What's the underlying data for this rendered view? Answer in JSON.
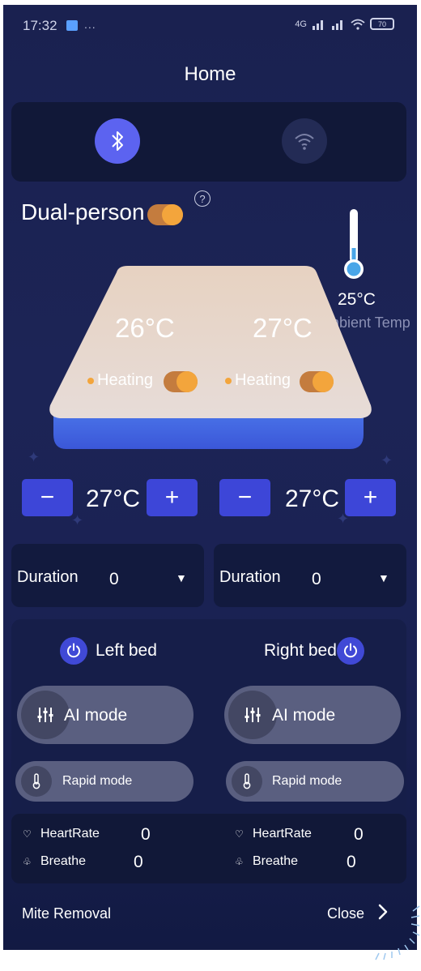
{
  "status_bar": {
    "time": "17:32",
    "dots": "...",
    "signal_text": "4G",
    "battery": "70"
  },
  "header": {
    "title": "Home"
  },
  "connection": {
    "bluetooth_icon": "bluetooth-icon",
    "wifi_icon": "wifi-icon"
  },
  "dual_person": {
    "label": "Dual-person",
    "enabled": true,
    "help_icon": "question-icon"
  },
  "ambient": {
    "temp": "25°C",
    "label": "Ambient Temp"
  },
  "bed": {
    "left": {
      "temp": "26°C",
      "status": "Heating"
    },
    "right": {
      "temp": "27°C",
      "status": "Heating"
    }
  },
  "controls": {
    "left": {
      "minus": "−",
      "value": "27°C",
      "plus": "+"
    },
    "right": {
      "minus": "−",
      "value": "27°C",
      "plus": "+"
    }
  },
  "duration": {
    "left": {
      "label": "Duration",
      "value": "0"
    },
    "right": {
      "label": "Duration",
      "value": "0"
    }
  },
  "beds": {
    "left": {
      "name": "Left bed",
      "ai_mode": "AI mode",
      "rapid_mode": "Rapid mode"
    },
    "right": {
      "name": "Right bed",
      "ai_mode": "AI mode",
      "rapid_mode": "Rapid mode"
    }
  },
  "stats": {
    "left": {
      "heart_label": "HeartRate",
      "heart_value": "0",
      "breathe_label": "Breathe",
      "breathe_value": "0"
    },
    "right": {
      "heart_label": "HeartRate",
      "heart_value": "0",
      "breathe_label": "Breathe",
      "breathe_value": "0"
    }
  },
  "mite_removal": {
    "label": "Mite Removal",
    "status": "Close"
  },
  "colors": {
    "accent": "#3d46d8",
    "heating": "#f3a53c",
    "background": "#1a2150"
  }
}
